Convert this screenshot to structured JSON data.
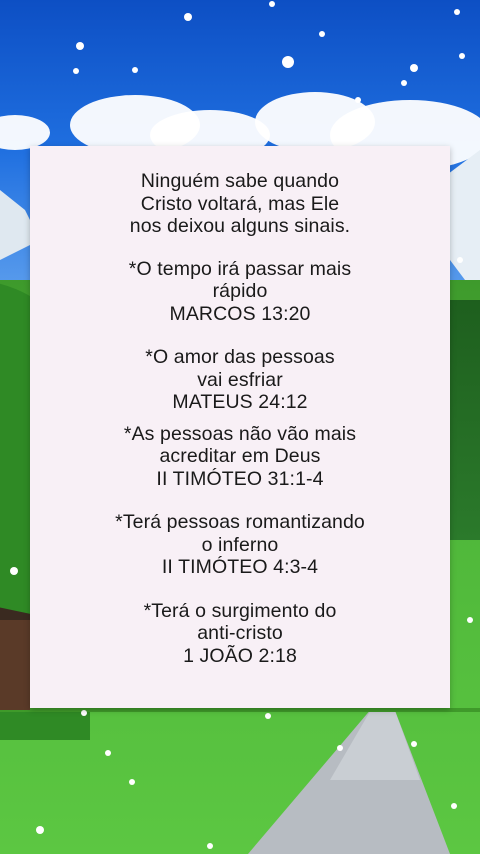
{
  "card": {
    "intro": [
      "Ninguém sabe quando",
      "Cristo voltará, mas Ele",
      "nos deixou alguns sinais."
    ],
    "signs": [
      {
        "lines": [
          "*O tempo irá passar mais",
          "rápido"
        ],
        "reference": "MARCOS 13:20"
      },
      {
        "lines": [
          "*O amor das pessoas",
          "vai esfriar"
        ],
        "reference": "MATEUS 24:12"
      },
      {
        "lines": [
          "*As pessoas não vão mais",
          "acreditar em Deus"
        ],
        "reference": "II TIMÓTEO 31:1-4"
      },
      {
        "lines": [
          "*Terá pessoas romantizando",
          "o inferno"
        ],
        "reference": "II TIMÓTEO 4:3-4"
      },
      {
        "lines": [
          "*Terá o surgimento do",
          "anti-cristo"
        ],
        "reference": "1 JOÃO 2:18"
      }
    ]
  },
  "colors": {
    "sky": "#1f6fe0",
    "grass": "#4fb73a",
    "card": "#f8f0f6",
    "text": "#1a1a1a"
  }
}
